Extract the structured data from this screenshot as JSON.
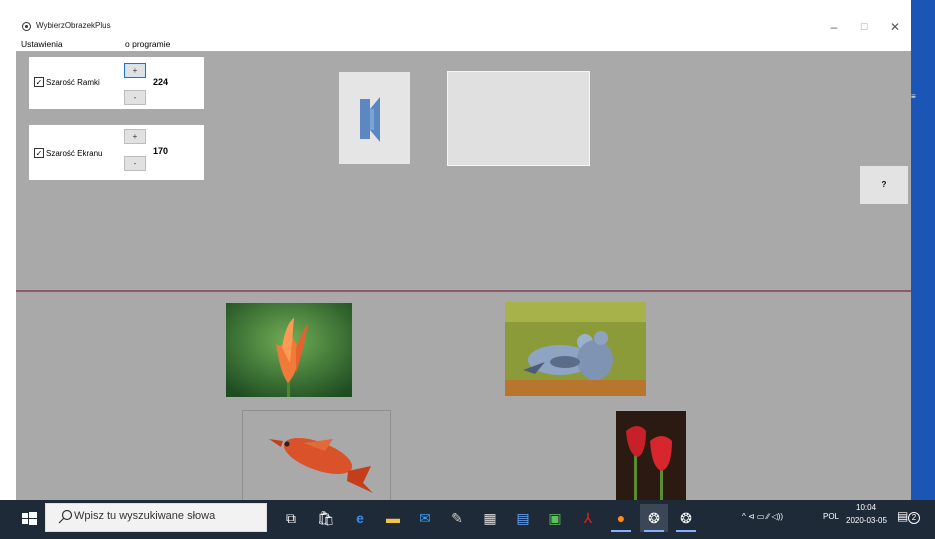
{
  "window": {
    "title": "WybierzObrazekPlus",
    "min_glyph": "–",
    "max_glyph": "☐",
    "close_glyph": "✕"
  },
  "menu": {
    "items": [
      {
        "label": "Ustawienia"
      },
      {
        "label": "o programie"
      }
    ]
  },
  "settings": {
    "frame_gray": {
      "label": "Szarość Ramki",
      "checked": true,
      "plus": "+",
      "minus": "-",
      "value": "224"
    },
    "screen_gray": {
      "label": "Szarość Ekranu",
      "checked": true,
      "plus": "+",
      "minus": "-",
      "value": "170"
    }
  },
  "toolbar": {
    "speaker_icon": "speaker-icon",
    "help_label": "?"
  },
  "images": [
    {
      "name": "tulip-orange"
    },
    {
      "name": "pigeons"
    },
    {
      "name": "fish"
    },
    {
      "name": "tulips-red"
    }
  ],
  "taskbar": {
    "search_placeholder": "Wpisz tu wyszukiwane słowa",
    "tray": {
      "icons": "^ ⊲ ▭ ∕∕ ◁))",
      "language": "POL",
      "time": "10:04",
      "date": "2020-03-05",
      "notification_count": "2"
    }
  },
  "colors": {
    "panel_gray": "#a9a9a9",
    "accent": "#1a73d9",
    "taskbar": "#1f2a38"
  }
}
